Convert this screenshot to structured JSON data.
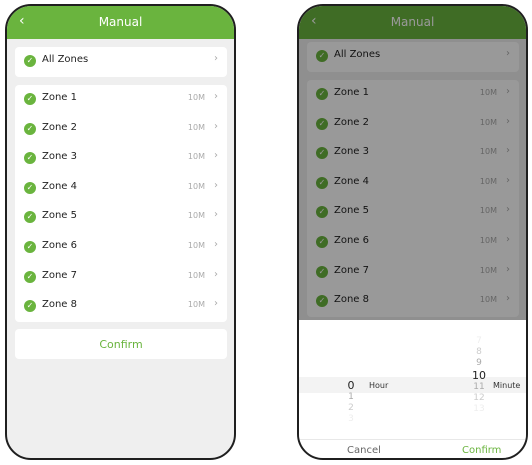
{
  "colors": {
    "brand": "#6ab43e",
    "background": "#efefef"
  },
  "header": {
    "back_icon": "chevron-left-icon",
    "title": "Manual"
  },
  "all_zones": {
    "label": "All Zones"
  },
  "zones": [
    {
      "label": "Zone 1",
      "duration": "10M"
    },
    {
      "label": "Zone 2",
      "duration": "10M"
    },
    {
      "label": "Zone 3",
      "duration": "10M"
    },
    {
      "label": "Zone 4",
      "duration": "10M"
    },
    {
      "label": "Zone 5",
      "duration": "10M"
    },
    {
      "label": "Zone 6",
      "duration": "10M"
    },
    {
      "label": "Zone 7",
      "duration": "10M"
    },
    {
      "label": "Zone 8",
      "duration": "10M"
    }
  ],
  "confirm_label": "Confirm",
  "picker": {
    "hour": {
      "above": [],
      "selected": "0",
      "below": [
        "1",
        "2",
        "3"
      ],
      "unit": "Hour"
    },
    "minute": {
      "above": [
        "7",
        "8",
        "9"
      ],
      "selected": "10",
      "below": [
        "11",
        "12",
        "13"
      ],
      "unit": "Minute"
    },
    "cancel_label": "Cancel",
    "confirm_label": "Confirm"
  }
}
